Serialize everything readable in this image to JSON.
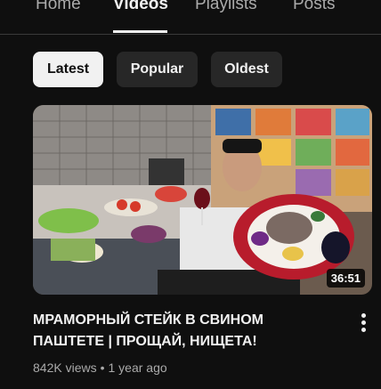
{
  "tabs": [
    {
      "label": "Home"
    },
    {
      "label": "Videos"
    },
    {
      "label": "Playlists"
    },
    {
      "label": "Posts"
    }
  ],
  "active_tab": "Videos",
  "chips": [
    {
      "label": "Latest",
      "selected": true
    },
    {
      "label": "Popular",
      "selected": false
    },
    {
      "label": "Oldest",
      "selected": false
    }
  ],
  "video": {
    "duration": "36:51",
    "title": "МРАМОРНЫЙ СТЕЙК В СВИНОМ ПАШТЕТЕ | ПРОЩАЙ, НИЩЕТА!",
    "views": "842K views",
    "separator": "•",
    "age": "1 year ago"
  },
  "icons": {
    "more": "more-vert-icon"
  },
  "colors": {
    "background": "#0f0f0f",
    "chip": "#272727",
    "chip_selected": "#f1f1f1",
    "text_secondary": "#aaaaaa"
  }
}
